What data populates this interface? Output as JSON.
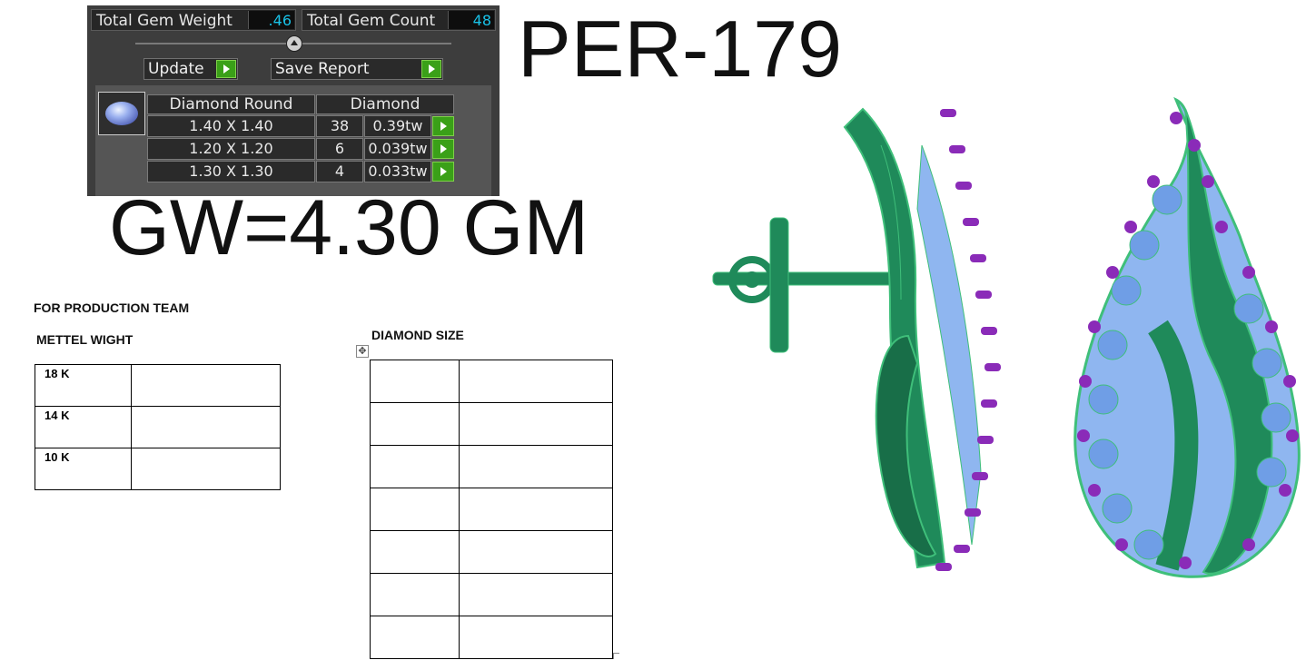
{
  "gem_panel": {
    "total_weight_label": "Total Gem Weight",
    "total_weight_value": ".46",
    "total_count_label": "Total Gem Count",
    "total_count_value": "48",
    "update_label": "Update",
    "save_report_label": "Save Report",
    "col_shape": "Diamond Round",
    "col_type": "Diamond",
    "rows": [
      {
        "size": "1.40 X 1.40",
        "count": "38",
        "weight": "0.39tw"
      },
      {
        "size": "1.20 X 1.20",
        "count": "6",
        "weight": "0.039tw"
      },
      {
        "size": "1.30 X 1.30",
        "count": "4",
        "weight": "0.033tw"
      }
    ]
  },
  "product_code": "PER-179",
  "gross_weight": "GW=4.30 GM",
  "production": {
    "heading": "FOR PRODUCTION TEAM",
    "metal_heading": "METTEL WIGHT",
    "metals": [
      "18 K",
      "14 K",
      "10 K"
    ],
    "diamond_heading": "DIAMOND SIZE",
    "diamond_rows": 7
  },
  "colors": {
    "metal": "#1f8a5a",
    "metal_light": "#3fbf7a",
    "stone": "#8fb6f0",
    "prong": "#8a2bb8"
  }
}
